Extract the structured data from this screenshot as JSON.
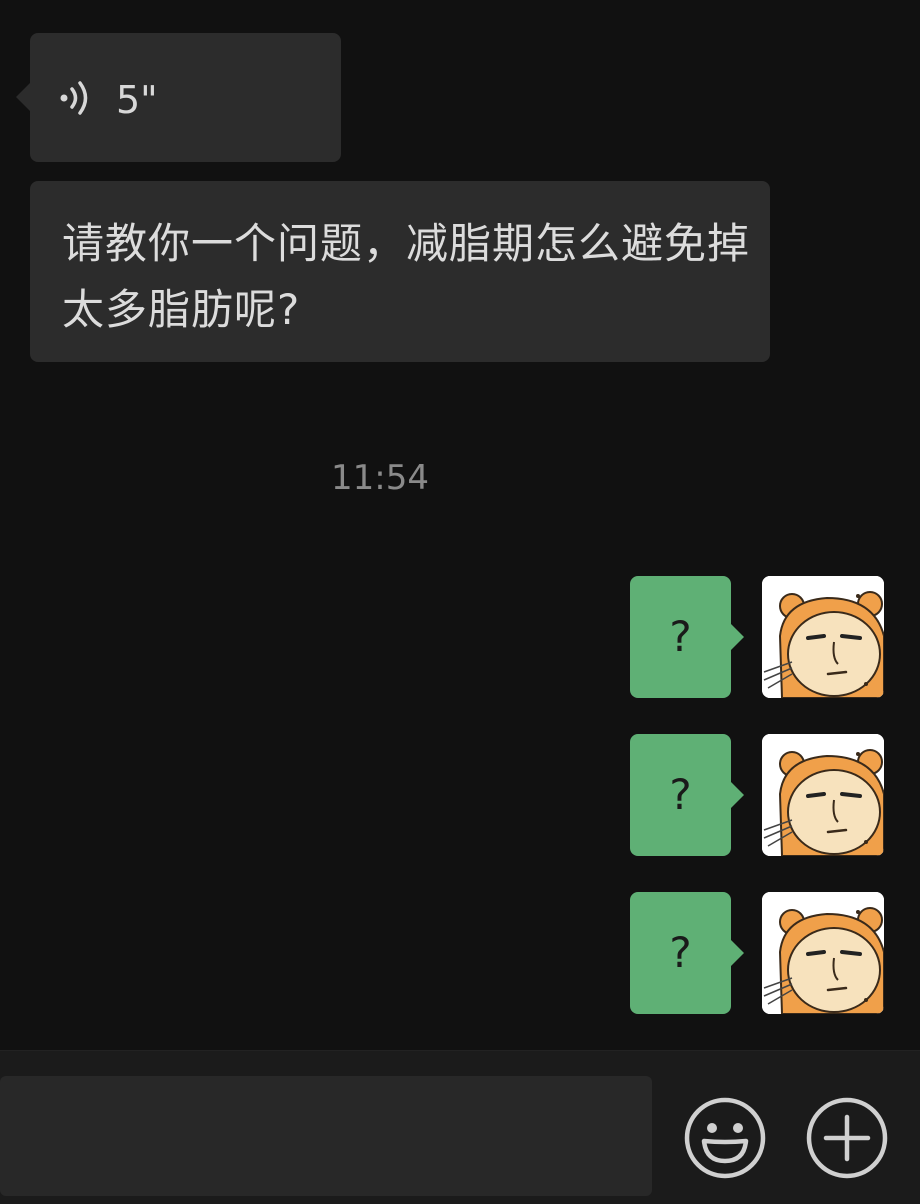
{
  "chat": {
    "incoming": [
      {
        "type": "voice",
        "duration": "5\"",
        "icon": "voice-wave-icon"
      },
      {
        "type": "text",
        "text": "请教你一个问题，减脂期怎么避免掉太多脂肪呢?"
      }
    ],
    "timestamp": "11:54",
    "outgoing": [
      {
        "text": "?",
        "avatar": "cartoon-bear-hood-avatar"
      },
      {
        "text": "?",
        "avatar": "cartoon-bear-hood-avatar"
      },
      {
        "text": "?",
        "avatar": "cartoon-bear-hood-avatar"
      }
    ]
  },
  "bottom_bar": {
    "input_value": "",
    "emoji_icon": "emoji-icon",
    "plus_icon": "plus-icon"
  },
  "colors": {
    "background": "#111111",
    "incoming_bubble": "#2c2c2c",
    "outgoing_bubble": "#5fb075",
    "avatar_orange": "#f0a04a"
  }
}
